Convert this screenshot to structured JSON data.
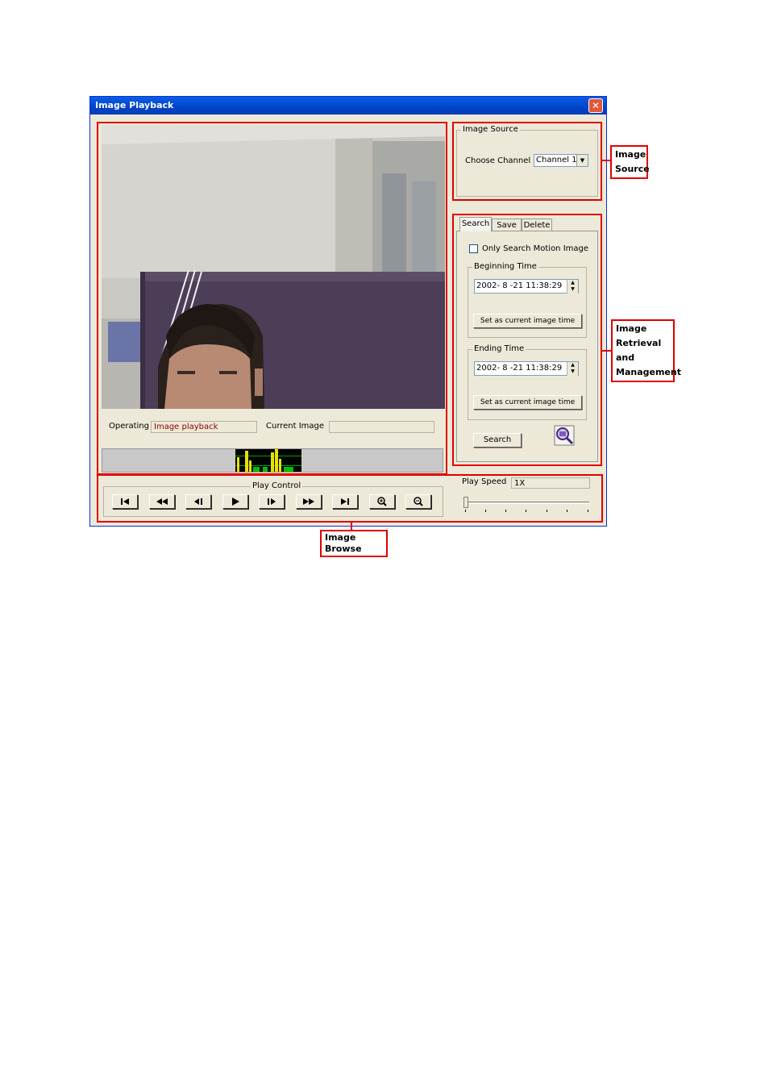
{
  "window": {
    "title": "Image Playback",
    "close_glyph": "✕"
  },
  "image_source": {
    "group_title": "Image Source",
    "choose_channel_label": "Choose Channel",
    "channel_value": "Channel 1"
  },
  "tabs": [
    {
      "label": "Search"
    },
    {
      "label": "Save"
    },
    {
      "label": "Delete"
    }
  ],
  "search": {
    "only_motion_label": "Only Search Motion Image",
    "beginning_title": "Beginning Time",
    "beginning_value": "2002- 8 -21 11:38:29",
    "ending_title": "Ending Time",
    "ending_value": "2002- 8 -21  11:38:29",
    "set_current_label": "Set as current image time",
    "search_button": "Search"
  },
  "status": {
    "operating_label": "Operating",
    "operating_value": "Image playback",
    "current_image_label": "Current Image",
    "current_image_value": ""
  },
  "play_control": {
    "title": "Play Control",
    "buttons": [
      "first-frame-icon",
      "rewind-icon",
      "step-back-icon",
      "play-icon",
      "step-forward-icon",
      "fast-forward-icon",
      "last-frame-icon",
      "zoom-in-icon",
      "zoom-out-icon"
    ]
  },
  "play_speed": {
    "label": "Play Speed",
    "value": "1X",
    "slider_fraction": 0
  },
  "callouts": {
    "image_source": "Image Source",
    "retrieval": "Image Retrieval and Management",
    "browse": "Image Browse"
  },
  "colors": {
    "annotation_red": "#e00000",
    "operating_text": "#8b0000",
    "title_blue": "#0a5fe6"
  }
}
